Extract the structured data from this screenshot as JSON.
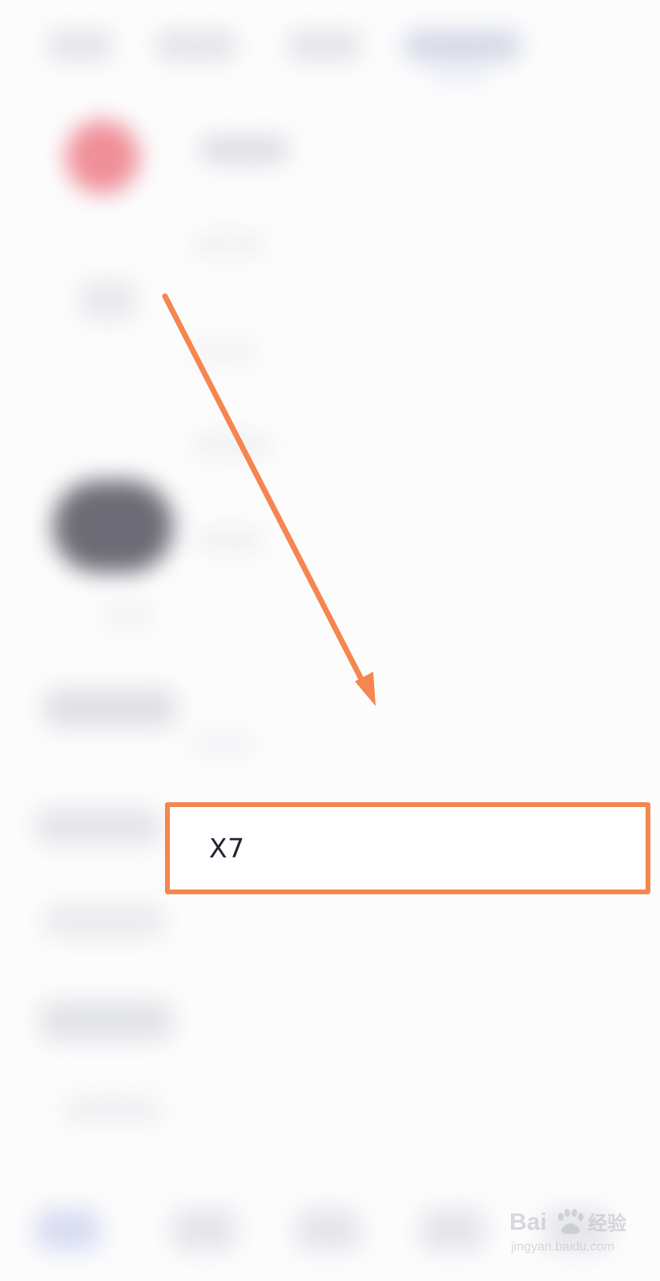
{
  "highlighted_option": {
    "label": "X7"
  },
  "watermark": {
    "brand": "Baidu经验",
    "url": "jingyan.baidu.com"
  },
  "colors": {
    "annotation": "#f5864f",
    "text": "#1e2430",
    "background": "#fcfcfd"
  }
}
